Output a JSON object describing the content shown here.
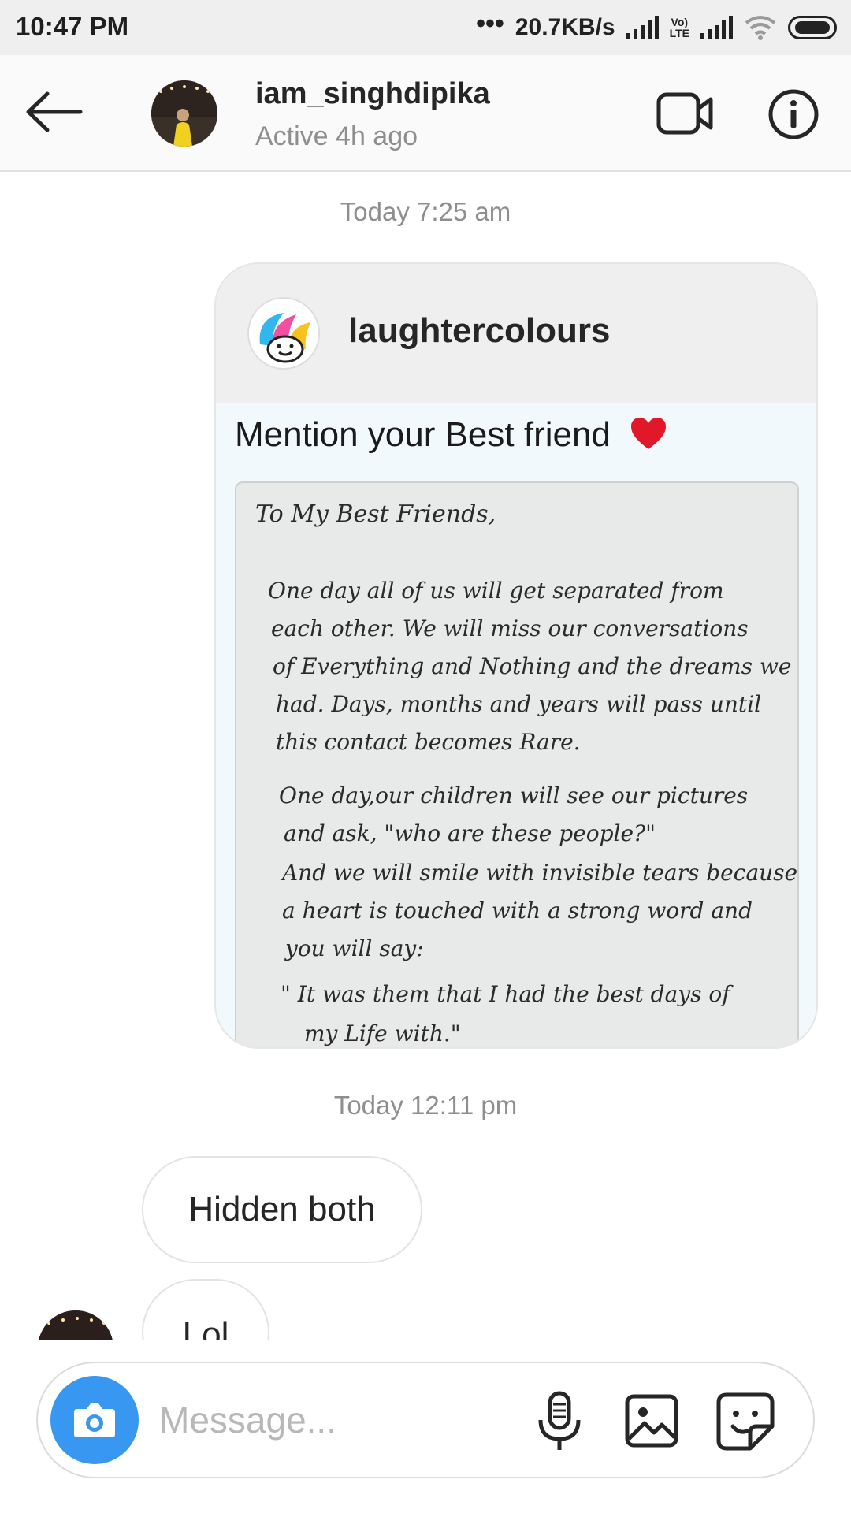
{
  "status_bar": {
    "time": "10:47 PM",
    "dots": "•••",
    "network_speed": "20.7KB/s",
    "volte_top": "Vo)",
    "volte_bottom": "LTE"
  },
  "header": {
    "username": "iam_singhdipika",
    "active_status": "Active 4h ago",
    "icons": [
      "back-arrow-icon",
      "video-camera-icon",
      "info-icon"
    ]
  },
  "thread": {
    "timestamp_1": "Today 7:25 am",
    "shared_post": {
      "author": "laughtercolours",
      "caption": "Mention your Best friend",
      "letter_lines": [
        "To My Best Friends,",
        "One day all of us will get separated from",
        "each other. We will miss our conversations",
        "of Everything and Nothing and the dreams we",
        "had. Days, months and years will pass until",
        "this contact becomes Rare.",
        "One day,our children will see our pictures",
        "and ask, \"who are these people?\"",
        "And we will smile with invisible tears because",
        "a heart is touched with a strong word and",
        "you will say:",
        "\" It was them that I had the best days of",
        "my Life with.\""
      ]
    },
    "timestamp_2": "Today 12:11 pm",
    "messages": [
      {
        "text": "Hidden both"
      },
      {
        "text": "Lol"
      }
    ]
  },
  "composer": {
    "placeholder": "Message...",
    "icons": [
      "camera-icon",
      "microphone-icon",
      "gallery-icon",
      "sticker-icon"
    ]
  },
  "colors": {
    "accent_blue": "#3897f0",
    "heart_red": "#e0182a",
    "muted_text": "#8e8e8e"
  }
}
